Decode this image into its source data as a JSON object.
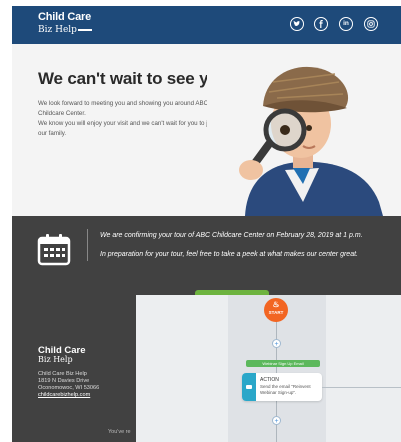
{
  "header": {
    "logo_line1": "Child Care",
    "logo_line2": "Biz Help",
    "social_icons": [
      "twitter-icon",
      "facebook-icon",
      "linkedin-icon",
      "instagram-icon"
    ],
    "colors": {
      "bar": "#1e4a7a"
    }
  },
  "hero": {
    "title": "We can't wait to see you!",
    "paragraph1": "We look forward to meeting you and showing you around ABC Childcare Center.",
    "paragraph2": "We know you will enjoy your visit and we can't wait for you to join our family."
  },
  "confirmation": {
    "line1": "We are confirming your tour of ABC Childcare Center on February 28, 2019 at 1 p.m.",
    "line2": "In preparation for your tour, feel free to take a peek at what makes our center great."
  },
  "footer": {
    "logo_line1": "Child Care",
    "logo_line2": "Biz Help",
    "address_name": "Child Care Biz Help",
    "address_street": "1819 N Davies Drive",
    "address_city": "Oconomowoc, WI 53066",
    "website": "childcarebizhelp.com",
    "youre_text": "You've re"
  },
  "flow": {
    "start_label": "START",
    "trigger_tag": "Webinar Sign Up Email",
    "action_title": "ACTION",
    "action_desc": "Send the email \"Reinvent Webinar Sign-up\".",
    "colors": {
      "start": "#f26522",
      "tag": "#5cb85c",
      "action": "#2aa7c9"
    }
  }
}
